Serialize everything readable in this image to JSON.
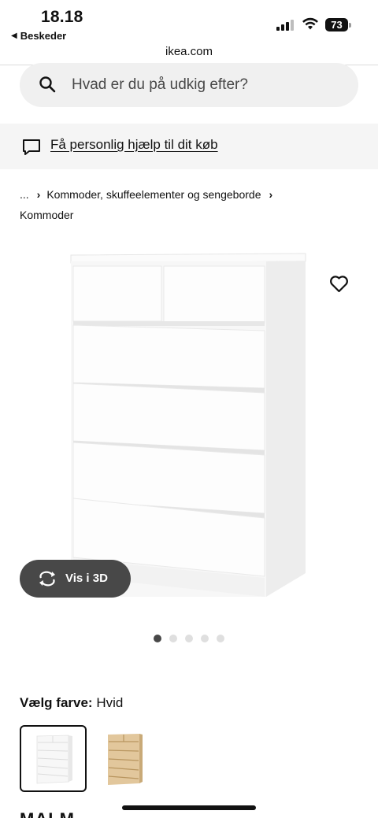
{
  "status_bar": {
    "time": "18.18",
    "back_app": "Beskeder",
    "battery": "73"
  },
  "browser": {
    "url": "ikea.com"
  },
  "search": {
    "placeholder": "Hvad er du på udkig efter?"
  },
  "help": {
    "label": "Få personlig hjælp til dit køb"
  },
  "breadcrumb": {
    "items": [
      "...",
      "Kommoder, skuffeelementer og sengeborde",
      "Kommoder"
    ]
  },
  "gallery": {
    "view3d_label": "Vis i 3D",
    "image_count": 5,
    "active_index": 0
  },
  "color": {
    "label": "Vælg farve:",
    "value": "Hvid",
    "options": [
      {
        "name": "Hvid",
        "selected": true,
        "color": "#f7f7f7"
      },
      {
        "name": "Egetræ",
        "selected": false,
        "color": "#e2c79c"
      }
    ]
  },
  "product": {
    "name": "MALM"
  },
  "colors": {
    "accent_dark": "#484848",
    "search_bg": "#f0f0f0",
    "banner_bg": "#f5f5f5"
  }
}
